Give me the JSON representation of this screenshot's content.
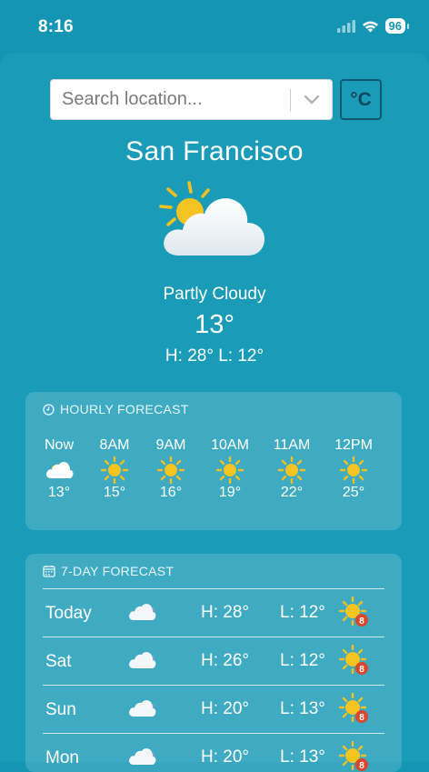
{
  "status": {
    "time": "8:16",
    "battery": "96"
  },
  "search": {
    "placeholder": "Search location...",
    "unit_label": "°C"
  },
  "current": {
    "city": "San Francisco",
    "condition": "Partly Cloudy",
    "temp": "13°",
    "hilo": "H: 28°  L: 12°",
    "icon": "partly-cloudy-icon"
  },
  "hourly": {
    "title": "HOURLY FORECAST",
    "items": [
      {
        "label": "Now",
        "temp": "13°",
        "icon": "cloud-icon"
      },
      {
        "label": "8AM",
        "temp": "15°",
        "icon": "sun-icon"
      },
      {
        "label": "9AM",
        "temp": "16°",
        "icon": "sun-icon"
      },
      {
        "label": "10AM",
        "temp": "19°",
        "icon": "sun-icon"
      },
      {
        "label": "11AM",
        "temp": "22°",
        "icon": "sun-icon"
      },
      {
        "label": "12PM",
        "temp": "25°",
        "icon": "sun-icon"
      }
    ]
  },
  "daily": {
    "title": "7-DAY FORECAST",
    "items": [
      {
        "day": "Today",
        "hi": "H: 28°",
        "lo": "L: 12°",
        "uv": "8"
      },
      {
        "day": "Sat",
        "hi": "H: 26°",
        "lo": "L: 12°",
        "uv": "8"
      },
      {
        "day": "Sun",
        "hi": "H: 20°",
        "lo": "L: 13°",
        "uv": "8"
      },
      {
        "day": "Mon",
        "hi": "H: 20°",
        "lo": "L: 13°",
        "uv": "8"
      }
    ]
  },
  "colors": {
    "background": "#1395b3",
    "sun": "#f7c21e",
    "uv_badge": "#d9482b"
  }
}
